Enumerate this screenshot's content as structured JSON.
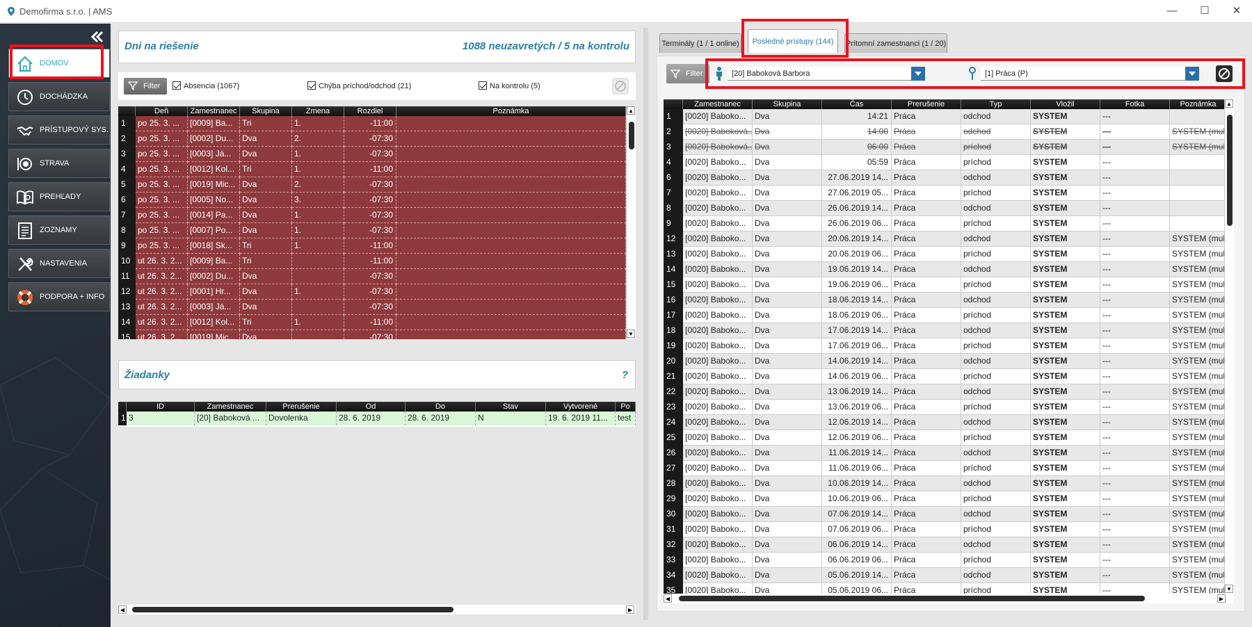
{
  "app": {
    "title": "Demofirma s.r.o. | AMS"
  },
  "window": {
    "minimize": "—",
    "maximize": "☐",
    "close": "✕"
  },
  "sidebar": {
    "items": [
      {
        "label": "DOMOV",
        "icon": "home-icon",
        "active": true
      },
      {
        "label": "DOCHÁDZKA",
        "icon": "clock-icon"
      },
      {
        "label": "PRÍSTUPOVÝ SYS.",
        "icon": "handshake-icon"
      },
      {
        "label": "STRAVA",
        "icon": "plate-icon"
      },
      {
        "label": "PREHĽADY",
        "icon": "book-search-icon"
      },
      {
        "label": "ZOZNAMY",
        "icon": "list-icon"
      },
      {
        "label": "NASTAVENIA",
        "icon": "tools-icon"
      },
      {
        "label": "PODPORA + INFO",
        "icon": "lifebuoy-icon"
      }
    ]
  },
  "days": {
    "title": "Dni na riešenie",
    "summary": "1088 neuzavretých / 5 na kontrolu",
    "filter_label": "Filter",
    "checks": [
      "Absencia (1067)",
      "Chýba príchod/odchod (21)",
      "Na kontrolu (5)"
    ],
    "columns": [
      "",
      "Deň",
      "Zamestnanec",
      "Skupina",
      "Zmena",
      "Rozdiel",
      "Poznámka"
    ],
    "rows": [
      [
        "1",
        "po 25. 3. ...",
        "[0009] Ba...",
        "Tri",
        "1.",
        "-11:00",
        ""
      ],
      [
        "2",
        "po 25. 3. ...",
        "[0002] Du...",
        "Dva",
        "2.",
        "-07:30",
        ""
      ],
      [
        "3",
        "po 25. 3. ...",
        "[0003] Já...",
        "Dva",
        "1.",
        "-07:30",
        ""
      ],
      [
        "4",
        "po 25. 3. ...",
        "[0012] Kol...",
        "Tri",
        "1.",
        "-11:00",
        ""
      ],
      [
        "5",
        "po 25. 3. ...",
        "[0019] Mic...",
        "Dva",
        "2.",
        "-07:30",
        ""
      ],
      [
        "6",
        "po 25. 3. ...",
        "[0005] No...",
        "Dva",
        "3.",
        "-07:30",
        ""
      ],
      [
        "7",
        "po 25. 3. ...",
        "[0014] Pa...",
        "Dva",
        "1.",
        "-07:30",
        ""
      ],
      [
        "8",
        "po 25. 3. ...",
        "[0007] Po...",
        "Dva",
        "1.",
        "-07:30",
        ""
      ],
      [
        "9",
        "po 25. 3. ...",
        "[0018] Sk...",
        "Tri",
        "1.",
        "-11:00",
        ""
      ],
      [
        "10",
        "ut 26. 3. 2...",
        "[0009] Ba...",
        "Tri",
        "",
        "-11:00",
        ""
      ],
      [
        "11",
        "ut 26. 3. 2...",
        "[0002] Du...",
        "Dva",
        "",
        "-07:30",
        ""
      ],
      [
        "12",
        "ut 26. 3. 2...",
        "[0001] Hr...",
        "Dva",
        "1.",
        "-07:30",
        ""
      ],
      [
        "13",
        "ut 26. 3. 2...",
        "[0003] Já...",
        "Dva",
        "",
        "-07:30",
        ""
      ],
      [
        "14",
        "ut 26. 3. 2...",
        "[0012] Kol...",
        "Tri",
        "1.",
        "-11:00",
        ""
      ],
      [
        "15",
        "ut 26. 3. 2...",
        "[0019] Mic...",
        "Dva",
        "",
        "-07:30",
        ""
      ]
    ]
  },
  "requests": {
    "title": "Žiadanky",
    "help": "?",
    "columns": [
      "",
      "ID",
      "Zamestnanec",
      "Prerušenie",
      "Od",
      "Do",
      "Stav",
      "Vytvorené",
      "Po"
    ],
    "rows": [
      [
        "1",
        "3",
        "[20] Baboková ...",
        "Dovolenka",
        "28. 6. 2019",
        "28. 6. 2019",
        "N",
        "19. 6. 2019 11...",
        "test"
      ]
    ]
  },
  "tabs": [
    {
      "label": "Terminály (1 / 1 online)"
    },
    {
      "label": "Posledné prístupy (144)",
      "active": true
    },
    {
      "label": "Prítomní zamestnanci (1 / 20)"
    }
  ],
  "access": {
    "filter_label": "Filter",
    "employee": "[20] Baboková Barbora",
    "type": "[1] Práca (P)",
    "columns": [
      "",
      "Zamestnanec",
      "Skupina",
      "Čas",
      "Prerušenie",
      "Typ",
      "Vložil",
      "Fotka",
      "Poznámka"
    ],
    "rows": [
      [
        "1",
        "[0020] Baboko...",
        "Dva",
        "14:21",
        "Práca",
        "odchod",
        "SYSTEM",
        "---",
        "",
        false
      ],
      [
        "2",
        "[0020] Baboková...",
        "Dva",
        "14:00",
        "Práca",
        "odchod",
        "SYSTEM",
        "---",
        "SYSTEM (multipl",
        true
      ],
      [
        "3",
        "[0020] Baboková...",
        "Dva",
        "06:00",
        "Práca",
        "príchod",
        "SYSTEM",
        "---",
        "SYSTEM (multipl",
        true
      ],
      [
        "4",
        "[0020] Baboko...",
        "Dva",
        "05:59",
        "Práca",
        "príchod",
        "SYSTEM",
        "---",
        "",
        false
      ],
      [
        "6",
        "[0020] Baboko...",
        "Dva",
        "27.06.2019 14...",
        "Práca",
        "odchod",
        "SYSTEM",
        "---",
        "",
        false
      ],
      [
        "7",
        "[0020] Baboko...",
        "Dva",
        "27.06.2019 05...",
        "Práca",
        "príchod",
        "SYSTEM",
        "---",
        "",
        false
      ],
      [
        "8",
        "[0020] Baboko...",
        "Dva",
        "26.06.2019 14...",
        "Práca",
        "odchod",
        "SYSTEM",
        "---",
        "",
        false
      ],
      [
        "9",
        "[0020] Baboko...",
        "Dva",
        "26.06.2019 06...",
        "Práca",
        "príchod",
        "SYSTEM",
        "---",
        "",
        false
      ],
      [
        "12",
        "[0020] Baboko...",
        "Dva",
        "20.06.2019 14...",
        "Práca",
        "odchod",
        "SYSTEM",
        "---",
        "SYSTEM (mult",
        false
      ],
      [
        "13",
        "[0020] Baboko...",
        "Dva",
        "20.06.2019 06...",
        "Práca",
        "príchod",
        "SYSTEM",
        "---",
        "SYSTEM (mult",
        false
      ],
      [
        "14",
        "[0020] Baboko...",
        "Dva",
        "19.06.2019 14...",
        "Práca",
        "odchod",
        "SYSTEM",
        "---",
        "SYSTEM (mult",
        false
      ],
      [
        "15",
        "[0020] Baboko...",
        "Dva",
        "19.06.2019 06...",
        "Práca",
        "príchod",
        "SYSTEM",
        "---",
        "SYSTEM (mult",
        false
      ],
      [
        "16",
        "[0020] Baboko...",
        "Dva",
        "18.06.2019 14...",
        "Práca",
        "odchod",
        "SYSTEM",
        "---",
        "SYSTEM (mult",
        false
      ],
      [
        "17",
        "[0020] Baboko...",
        "Dva",
        "18.06.2019 06...",
        "Práca",
        "príchod",
        "SYSTEM",
        "---",
        "SYSTEM (mult",
        false
      ],
      [
        "18",
        "[0020] Baboko...",
        "Dva",
        "17.06.2019 14...",
        "Práca",
        "odchod",
        "SYSTEM",
        "---",
        "SYSTEM (mult",
        false
      ],
      [
        "19",
        "[0020] Baboko...",
        "Dva",
        "17.06.2019 06...",
        "Práca",
        "príchod",
        "SYSTEM",
        "---",
        "SYSTEM (mult",
        false
      ],
      [
        "20",
        "[0020] Baboko...",
        "Dva",
        "14.06.2019 14...",
        "Práca",
        "odchod",
        "SYSTEM",
        "---",
        "SYSTEM (mult",
        false
      ],
      [
        "21",
        "[0020] Baboko...",
        "Dva",
        "14.06.2019 06...",
        "Práca",
        "príchod",
        "SYSTEM",
        "---",
        "SYSTEM (mult",
        false
      ],
      [
        "22",
        "[0020] Baboko...",
        "Dva",
        "13.06.2019 14...",
        "Práca",
        "odchod",
        "SYSTEM",
        "---",
        "SYSTEM (mult",
        false
      ],
      [
        "23",
        "[0020] Baboko...",
        "Dva",
        "13.06.2019 06...",
        "Práca",
        "príchod",
        "SYSTEM",
        "---",
        "SYSTEM (mult",
        false
      ],
      [
        "24",
        "[0020] Baboko...",
        "Dva",
        "12.06.2019 14...",
        "Práca",
        "odchod",
        "SYSTEM",
        "---",
        "SYSTEM (mult",
        false
      ],
      [
        "25",
        "[0020] Baboko...",
        "Dva",
        "12.06.2019 06...",
        "Práca",
        "príchod",
        "SYSTEM",
        "---",
        "SYSTEM (mult",
        false
      ],
      [
        "26",
        "[0020] Baboko...",
        "Dva",
        "11.06.2019 14...",
        "Práca",
        "odchod",
        "SYSTEM",
        "---",
        "SYSTEM (mult",
        false
      ],
      [
        "27",
        "[0020] Baboko...",
        "Dva",
        "11.06.2019 06...",
        "Práca",
        "príchod",
        "SYSTEM",
        "---",
        "SYSTEM (mult",
        false
      ],
      [
        "28",
        "[0020] Baboko...",
        "Dva",
        "10.06.2019 14...",
        "Práca",
        "odchod",
        "SYSTEM",
        "---",
        "SYSTEM (mult",
        false
      ],
      [
        "29",
        "[0020] Baboko...",
        "Dva",
        "10.06.2019 06...",
        "Práca",
        "príchod",
        "SYSTEM",
        "---",
        "SYSTEM (mult",
        false
      ],
      [
        "30",
        "[0020] Baboko...",
        "Dva",
        "07.06.2019 14...",
        "Práca",
        "odchod",
        "SYSTEM",
        "---",
        "SYSTEM (mult",
        false
      ],
      [
        "31",
        "[0020] Baboko...",
        "Dva",
        "07.06.2019 06...",
        "Práca",
        "príchod",
        "SYSTEM",
        "---",
        "SYSTEM (mult",
        false
      ],
      [
        "32",
        "[0020] Baboko...",
        "Dva",
        "06.06.2019 14...",
        "Práca",
        "odchod",
        "SYSTEM",
        "---",
        "SYSTEM (mult",
        false
      ],
      [
        "33",
        "[0020] Baboko...",
        "Dva",
        "06.06.2019 06...",
        "Práca",
        "príchod",
        "SYSTEM",
        "---",
        "SYSTEM (mult",
        false
      ],
      [
        "34",
        "[0020] Baboko...",
        "Dva",
        "05.06.2019 14...",
        "Práca",
        "odchod",
        "SYSTEM",
        "---",
        "SYSTEM (mult",
        false
      ],
      [
        "35",
        "[0020] Baboko...",
        "Dva",
        "05.06.2019 06...",
        "Práca",
        "príchod",
        "SYSTEM",
        "---",
        "SYSTEM (mult",
        false
      ]
    ]
  },
  "colors": {
    "accent": "#2a7fa8",
    "highlight": "#e8141f",
    "absence_row": "#8e3a3d",
    "request_row": "#d8f8d8"
  }
}
